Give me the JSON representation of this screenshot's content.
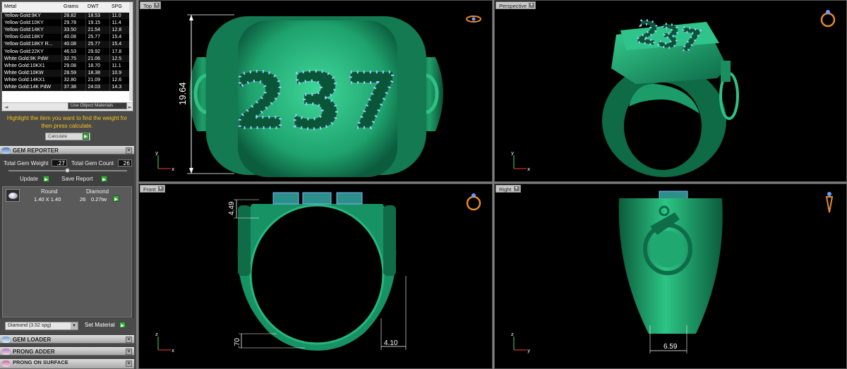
{
  "metals": {
    "headers": [
      "Metal",
      "Grams",
      "DWT",
      "SPG"
    ],
    "rows": [
      [
        "Yellow Gold:9KY",
        "28.82",
        "18.53",
        "11.0"
      ],
      [
        "Yellow Gold:10KY",
        "29.78",
        "19.15",
        "11.4"
      ],
      [
        "Yellow Gold:14KY",
        "33.50",
        "21.54",
        "12.8"
      ],
      [
        "Yellow Gold:18KY",
        "40.08",
        "25.77",
        "15.4"
      ],
      [
        "Yellow Gold:18KY R...",
        "40.08",
        "25.77",
        "15.4"
      ],
      [
        "Yellow Gold:22KY",
        "46.53",
        "29.92",
        "17.8"
      ],
      [
        "White Gold:9K PdW",
        "32.75",
        "21.06",
        "12.5"
      ],
      [
        "White Gold:10KX1",
        "29.08",
        "18.70",
        "11.1"
      ],
      [
        "White Gold:10KW",
        "28.59",
        "18.38",
        "10.9"
      ],
      [
        "White Gold:14KX1",
        "32.80",
        "21.09",
        "12.6"
      ],
      [
        "White Gold:14K PdW",
        "37.38",
        "24.03",
        "14.3"
      ]
    ],
    "scroll_left": "◄",
    "scroll_right": "►"
  },
  "use_object_materials": "Use Object Materials",
  "hint": "Highlight the item you want to find the weight for then press calculate.",
  "calculate_label": "Calculate",
  "gem_reporter": {
    "title": "GEM REPORTER",
    "total_weight_label": "Total Gem Weight",
    "total_weight": ".27",
    "total_count_label": "Total Gem Count",
    "total_count": "26",
    "update_label": "Update",
    "save_report_label": "Save Report",
    "col_shape": "Round",
    "col_material": "Diamond",
    "row_size": "1.40 X 1.40",
    "row_count": "26",
    "row_weight": "0.27tw"
  },
  "material_select": "Diamond       (3.52 spg)",
  "set_material_label": "Set Material",
  "panels": {
    "gem_loader": "GEM LOADER",
    "prong_adder": "PRONG ADDER",
    "prong_on_surface": "PRONG ON SURFACE"
  },
  "viewports": {
    "top": {
      "label": "Top",
      "engraving": "237",
      "dim": "19.64"
    },
    "perspective": {
      "label": "Perspective"
    },
    "front": {
      "label": "Front",
      "dim_a": "4.49",
      "dim_b": ".70",
      "dim_c": "4.10"
    },
    "right": {
      "label": "Right",
      "dim": "6.59"
    }
  },
  "axis": {
    "x": "x",
    "y": "y",
    "z": "z"
  },
  "colors": {
    "metal_green": "#1e9e6c",
    "hint_yellow": "#f5c518",
    "accent_button": "#3cab3c",
    "background": "#000000"
  }
}
